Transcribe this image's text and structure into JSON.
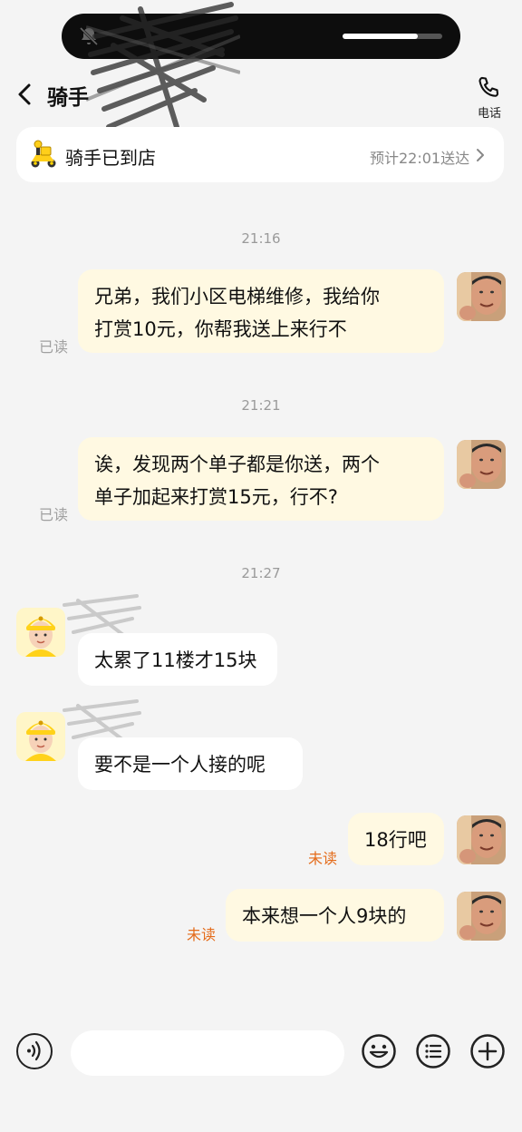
{
  "status_bar": {
    "notifications_muted": true,
    "progress": 0.75
  },
  "header": {
    "title": "骑手",
    "call_label": "电话"
  },
  "order_card": {
    "status": "骑手已到店",
    "eta": "预计22:01送达"
  },
  "messages": {
    "ts1": "21:16",
    "m1": {
      "lines": [
        "兄弟，我们小区电梯维修，我给你",
        "打赏10元，你帮我送上来行不"
      ],
      "status": "已读"
    },
    "ts2": "21:21",
    "m2": {
      "lines": [
        "诶，发现两个单子都是你送，两个",
        "单子加起来打赏15元，行不?"
      ],
      "status": "已读"
    },
    "ts3": "21:27",
    "m3": {
      "text": "太累了11楼才15块"
    },
    "m4": {
      "text": "要不是一个人接的呢"
    },
    "m5": {
      "text": "18行吧",
      "status": "未读"
    },
    "m6": {
      "text": "本来想一个人9块的",
      "status": "未读"
    }
  },
  "input_bar": {
    "placeholder": ""
  },
  "colors": {
    "outgoing_bubble": "#fff9e2",
    "incoming_bubble": "#ffffff",
    "unread": "#e46b1a",
    "background": "#f4f4f4"
  }
}
